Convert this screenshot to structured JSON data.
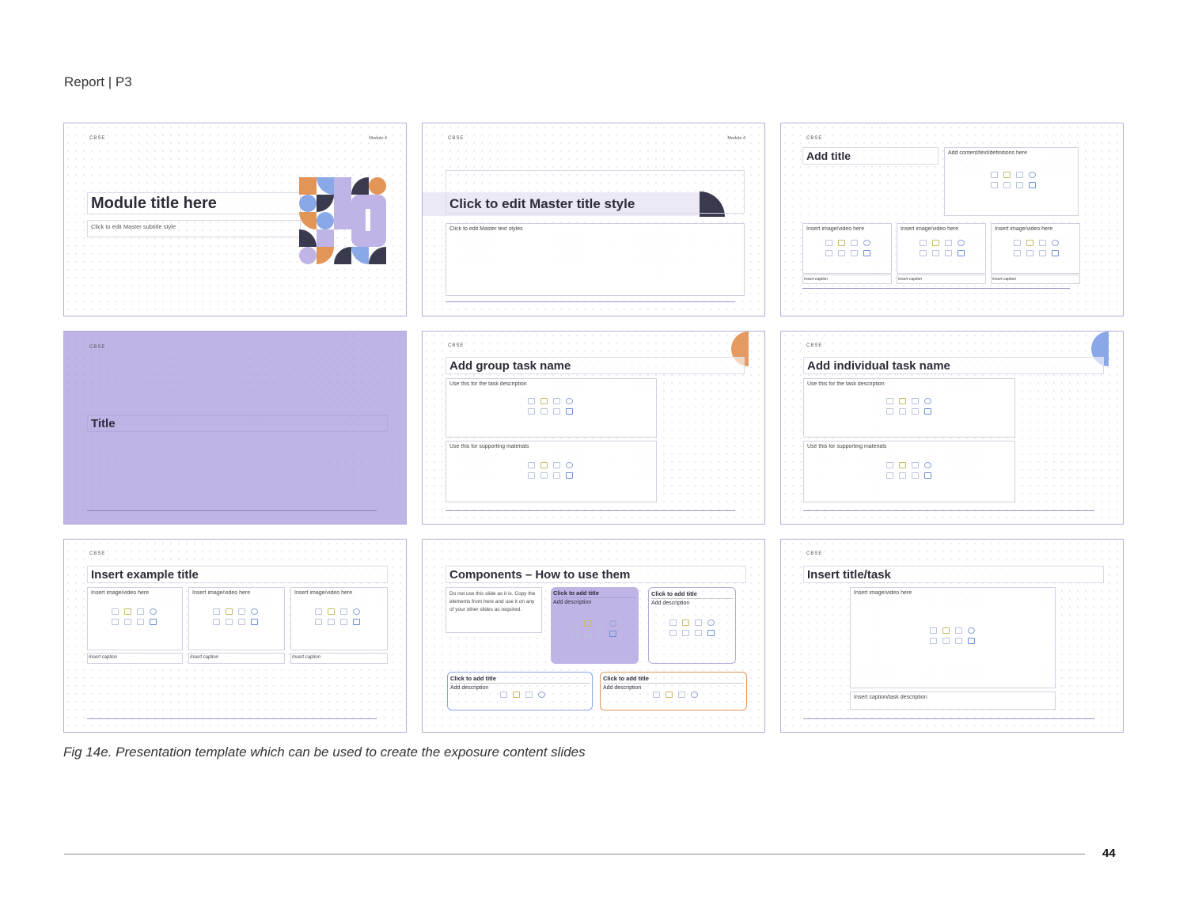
{
  "header": {
    "title": "Report | P3"
  },
  "slides": {
    "s1": {
      "logo": "CBSE",
      "module": "Module 4",
      "title": "Module title here",
      "subtitle": "Click to edit Master subtitle style"
    },
    "s2": {
      "logo": "CBSE",
      "module": "Module 4",
      "title": "Click to edit Master title style",
      "body": "Click to edit Master text styles"
    },
    "s3": {
      "logo": "CBSE",
      "title": "Add title",
      "content": "Add content/text/definitions here",
      "media": [
        "Insert image/video here",
        "Insert image/video here",
        "Insert image/video here"
      ],
      "captions": [
        "Insert caption",
        "Insert caption",
        "Insert caption"
      ]
    },
    "s4": {
      "logo": "CBSE",
      "title": "Title"
    },
    "s5": {
      "logo": "CBSE",
      "title": "Add group task name",
      "desc": "Use this for the task description",
      "support": "Use this for supporting materials"
    },
    "s6": {
      "logo": "CBSE",
      "title": "Add individual task name",
      "desc": "Use this for the task description",
      "support": "Use this for supporting materials"
    },
    "s7": {
      "logo": "CBSE",
      "title": "Insert example title",
      "media": [
        "Insert image/video here",
        "Insert image/video here",
        "Insert image/video here"
      ],
      "captions": [
        "Insert caption",
        "Insert caption",
        "Insert caption"
      ]
    },
    "s8": {
      "title": "Components – How to use them",
      "note": "Do not use this slide as it is. Copy the elements from here and use it on any of your other slides as required.",
      "card_title": "Click to add title",
      "card_desc": "Add description"
    },
    "s9": {
      "logo": "CBSE",
      "title": "Insert title/task",
      "media": "Insert image/video here",
      "caption": "Insert caption/task description"
    }
  },
  "caption": "Fig 14e. Presentation template which can be used to create the exposure content slides",
  "page_number": "44",
  "colors": {
    "lavender": "#c0b4e6",
    "orange": "#e39557",
    "navy": "#3a3a4e",
    "blue": "#8aa8e8",
    "border": "#b4acd8"
  }
}
